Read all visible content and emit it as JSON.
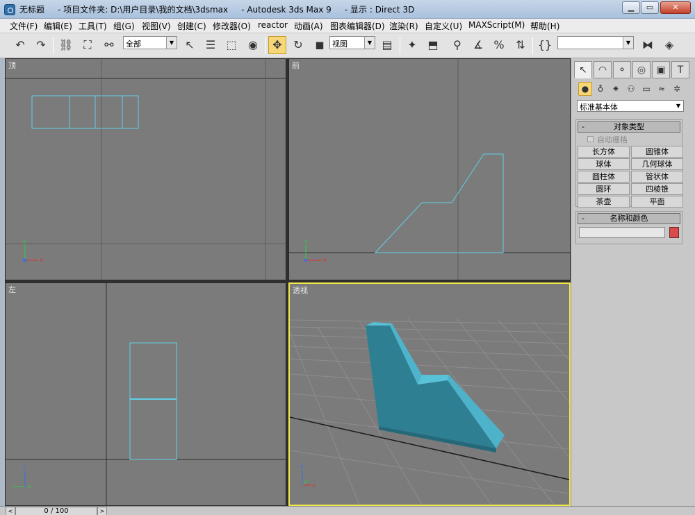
{
  "window": {
    "title": "无标题     - 项目文件夹: D:\\用户目录\\我的文档\\3dsmax     - Autodesk 3ds Max 9     - 显示 : Direct 3D"
  },
  "menu": [
    "文件(F)",
    "编辑(E)",
    "工具(T)",
    "组(G)",
    "视图(V)",
    "创建(C)",
    "修改器(O)",
    "reactor",
    "动画(A)",
    "图表编辑器(D)",
    "渲染(R)",
    "自定义(U)",
    "MAXScript(M)",
    "帮助(H)"
  ],
  "toolbar": {
    "selection_filter": "全部",
    "reference_coord": "视图",
    "named_selection": ""
  },
  "viewports": {
    "top": "顶",
    "front": "前",
    "left": "左",
    "perspective": "透视"
  },
  "axis_labels": {
    "x": "x",
    "y": "y",
    "z": "z"
  },
  "command_panel": {
    "category": "标准基本体",
    "object_type": {
      "header": "对象类型",
      "autogrid": "自动栅格",
      "buttons": [
        "长方体",
        "圆锥体",
        "球体",
        "几何球体",
        "圆柱体",
        "管状体",
        "圆环",
        "四棱锥",
        "茶壶",
        "平面"
      ]
    },
    "name_color": {
      "header": "名称和颜色",
      "name": "",
      "color": "#d94a4a"
    }
  },
  "timeline": {
    "frame_label": "0 / 100"
  },
  "colors": {
    "active_border": "#f2e94a",
    "wireframe": "#5fd0e6",
    "object_fill": "#3ea2b8"
  }
}
